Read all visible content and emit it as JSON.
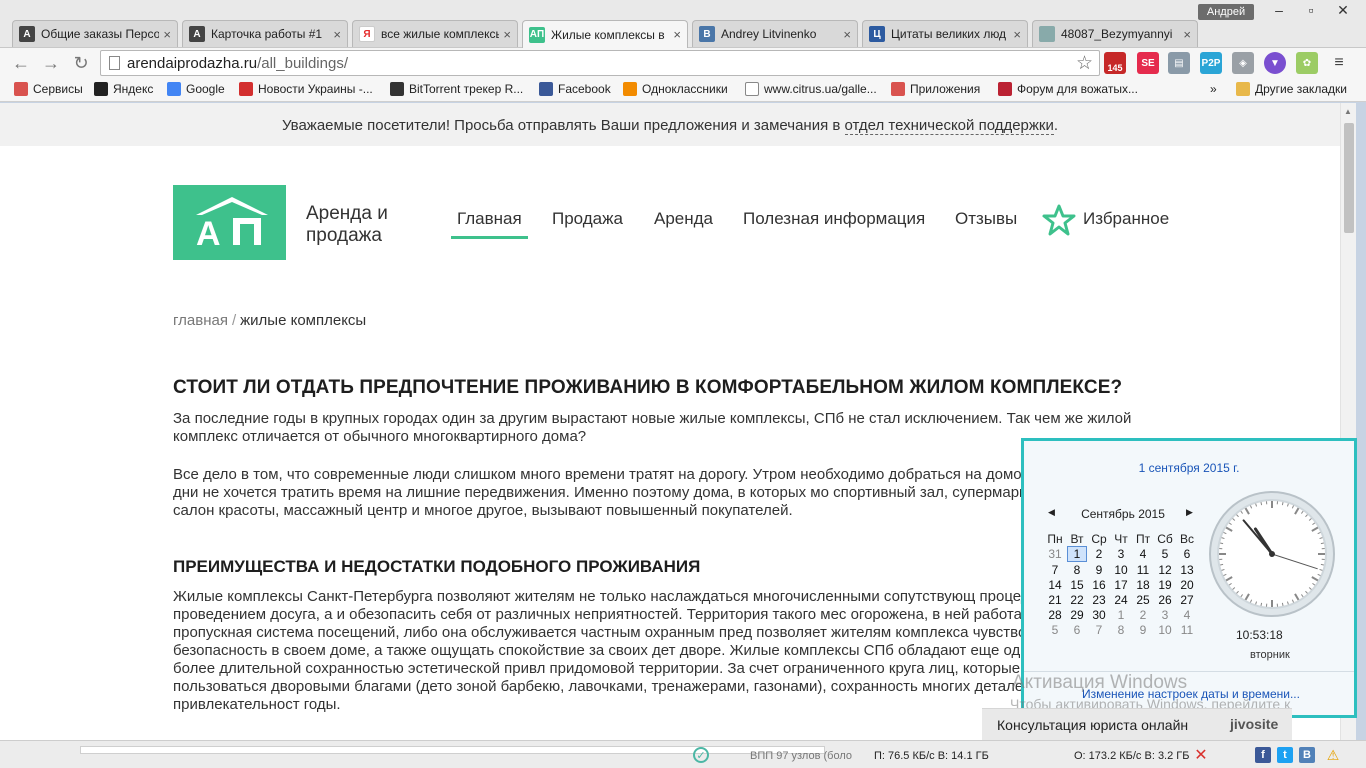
{
  "browser": {
    "user_name": "Андрей",
    "tabs": [
      {
        "title": "Общие заказы Персо",
        "icon_letter": "A",
        "icon_color": "#444444"
      },
      {
        "title": "Карточка работы #1",
        "icon_letter": "A",
        "icon_color": "#444444"
      },
      {
        "title": "все жилые комплексы",
        "icon_letter": "Я",
        "icon_color": "#ffffff"
      },
      {
        "title": "Жилые комплексы в",
        "icon_letter": "AП",
        "icon_color": "#3ec18c"
      },
      {
        "title": "Andrey Litvinenko",
        "icon_letter": "B",
        "icon_color": "#4a76a8"
      },
      {
        "title": "Цитаты великих люд",
        "icon_letter": "Ц",
        "icon_color": "#2c5aa0"
      },
      {
        "title": "48087_Bezymyannyi",
        "icon_letter": "",
        "icon_color": "#8aa"
      }
    ],
    "active_tab_index": 3,
    "url_host": "arendaiprodazha.ru",
    "url_path": "/all_buildings/",
    "bookmarks": [
      {
        "label": "Сервисы",
        "icon": "apps-icon"
      },
      {
        "label": "Яндекс",
        "icon": "yandex-icon"
      },
      {
        "label": "Google",
        "icon": "google-icon"
      },
      {
        "label": "Новости Украины -...",
        "icon": "news-icon"
      },
      {
        "label": "BitTorrent трекер R...",
        "icon": "torrent-icon"
      },
      {
        "label": "Facebook",
        "icon": "facebook-icon"
      },
      {
        "label": "Одноклассники",
        "icon": "ok-icon"
      },
      {
        "label": "www.citrus.ua/galle...",
        "icon": "page-icon"
      },
      {
        "label": "Приложения",
        "icon": "apps-icon"
      },
      {
        "label": "Форум для вожатых...",
        "icon": "forum-icon"
      }
    ],
    "bookmarks_overflow": "»",
    "other_bookmarks": "Другие закладки",
    "ext_mail_count": "145"
  },
  "site": {
    "notice_text": "Уважаемые посетители! Просьба отправлять Ваши предложения и замечания в",
    "notice_link": "отдел технической поддержки",
    "notice_end": ".",
    "logo_letters": "AП",
    "logo_line1": "Аренда и",
    "logo_line2": "продажа",
    "menu": [
      "Главная",
      "Продажа",
      "Аренда",
      "Полезная информация",
      "Отзывы"
    ],
    "favorites_label": "Избранное",
    "breadcrumb_home": "главная",
    "breadcrumb_sep": "/",
    "breadcrumb_current": "жилые комплексы",
    "heading1": "СТОИТ ЛИ ОТДАТЬ ПРЕДПОЧТЕНИЕ ПРОЖИВАНИЮ В КОМФОРТАБЕЛЬНОМ ЖИЛОМ КОМПЛЕКСЕ?",
    "para1": "За последние годы в крупных городах один за другим вырастают новые жилые комплексы, СПб не стал исключением. Так чем же жилой комплекс отличается от обычного многоквартирного дома?",
    "para2": "Все дело в том, что современные люди слишком много времени тратят на дорогу. Утром необходимо добраться на домой. А в выходные дни не хочется тратить время на лишние передвижения. Именно поэтому дома, в которых мо спортивный зал, супермаркет, бассейн, салон красоты, массажный центр и многое другое, вызывают повышенный покупателей.",
    "heading2": "ПРЕИМУЩЕСТВА И НЕДОСТАТКИ ПОДОБНОГО ПРОЖИВАНИЯ",
    "para3": "Жилые комплексы Санкт-Петербурга позволяют жителям не только наслаждаться многочисленными сопутствующ процедурами или проведением досуга, а и обезопасить себя от различных неприятностей. Территория такого мес огорожена, в ней работает либо пропускная система посещений, либо она обслуживается частным охранным пред позволяет жителям комплекса чувствовать безопасность в своем доме, а также ощущать спокойствие за своих дет дворе. Жилые комплексы СПб обладают еще одним плюсом – более длительной сохранностью эстетической привл придомовой территории. За счет ограниченного круга лиц, которые могут пользоваться дворовыми благами (дето зоной барбекю, лавочками, тренажерами, газонами), сохранность многих деталей не потеряет привлекательност годы."
  },
  "calendar": {
    "full_date": "1 сентября 2015 г.",
    "month_title": "Сентябрь 2015",
    "weekdays": [
      "Пн",
      "Вт",
      "Ср",
      "Чт",
      "Пт",
      "Сб",
      "Вс"
    ],
    "weeks": [
      [
        "31",
        "1",
        "2",
        "3",
        "4",
        "5",
        "6"
      ],
      [
        "7",
        "8",
        "9",
        "10",
        "11",
        "12",
        "13"
      ],
      [
        "14",
        "15",
        "16",
        "17",
        "18",
        "19",
        "20"
      ],
      [
        "21",
        "22",
        "23",
        "24",
        "25",
        "26",
        "27"
      ],
      [
        "28",
        "29",
        "30",
        "1",
        "2",
        "3",
        "4"
      ],
      [
        "5",
        "6",
        "7",
        "8",
        "9",
        "10",
        "11"
      ]
    ],
    "today": "1",
    "time": "10:53:18",
    "weekday_name": "вторник",
    "settings_link": "Изменение настроек даты и времени...",
    "clock_hours": 10,
    "clock_minutes": 53,
    "clock_seconds": 18
  },
  "overlay": {
    "activation_title": "Активация Windows",
    "activation_text": "Чтобы активировать Windows, перейдите к",
    "jivo_label": "Консультация юриста онлайн",
    "jivo_brand": "jivosite"
  },
  "status": {
    "peers": "ВПП 97 узлов (боло",
    "down": "П: 76.5 КБ/с В: 14.1 ГБ",
    "up": "О: 173.2 КБ/с В: 3.2 ГБ"
  }
}
